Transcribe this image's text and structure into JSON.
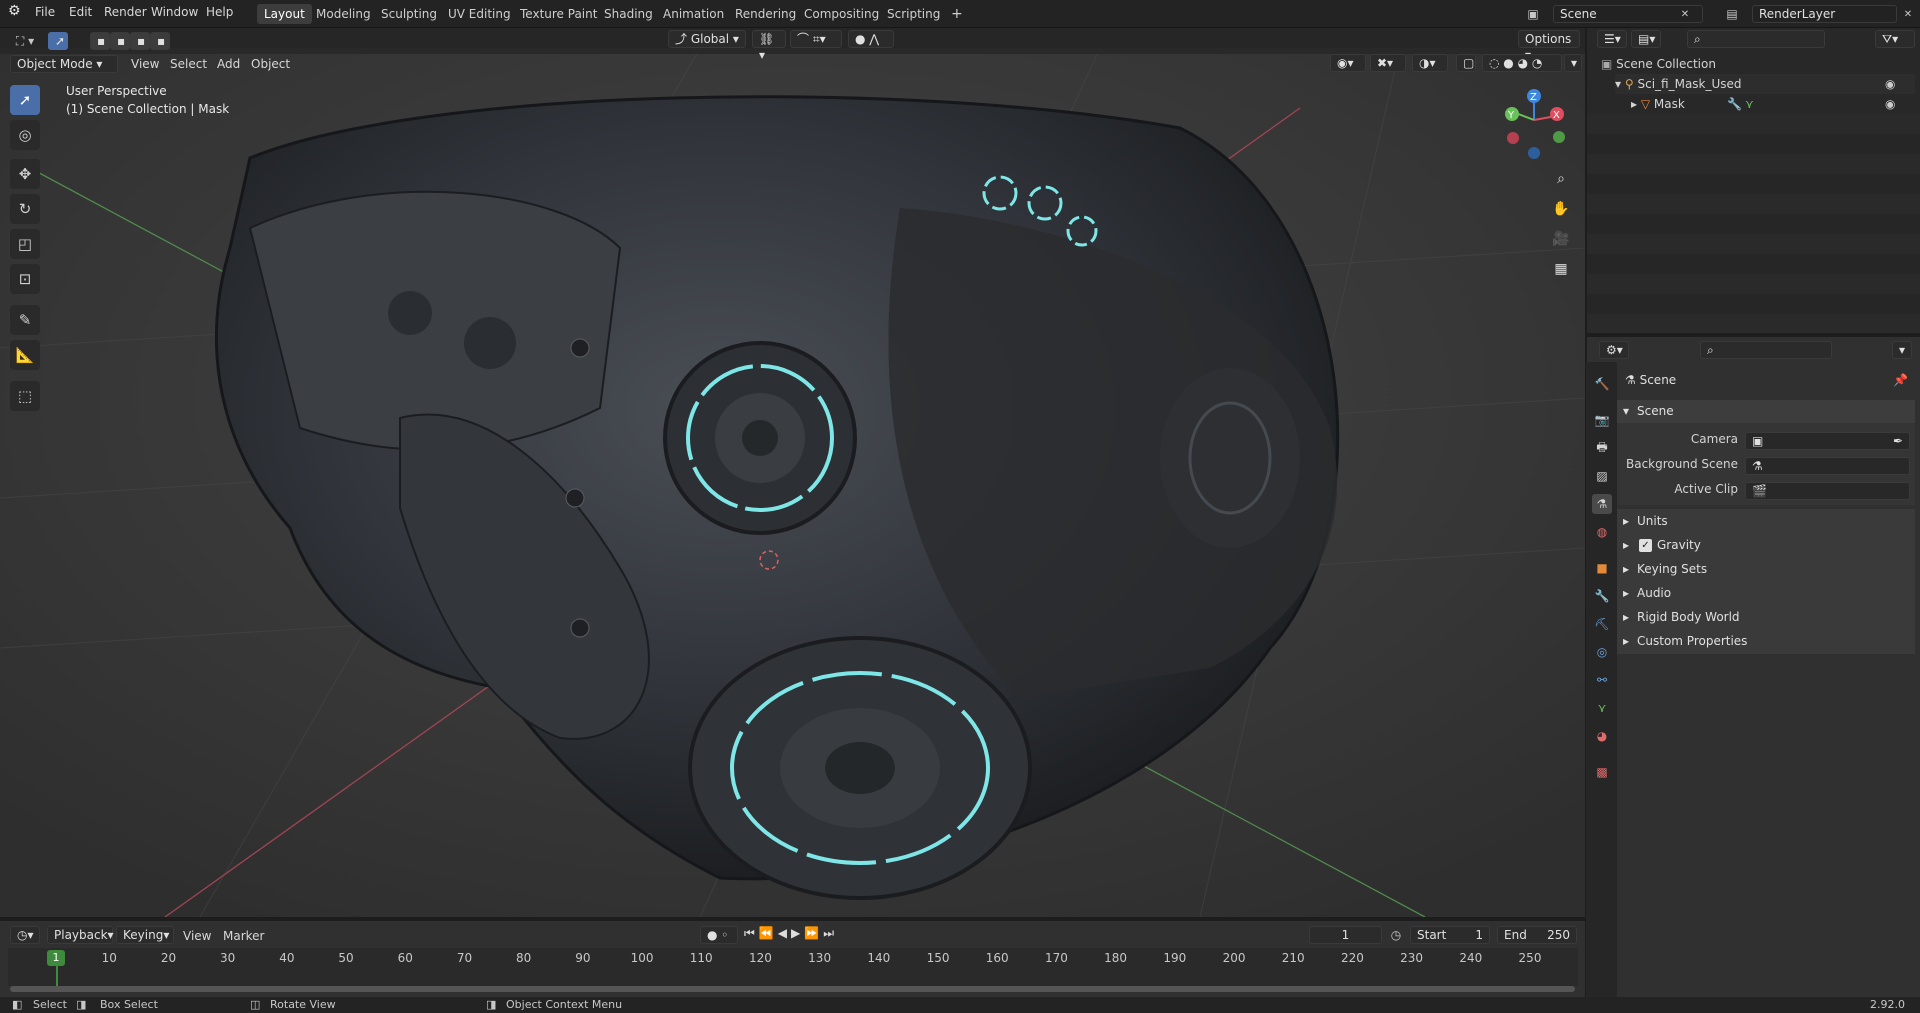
{
  "menubar": {
    "menus": [
      "File",
      "Edit",
      "Render",
      "Window",
      "Help"
    ],
    "workspaces": [
      "Layout",
      "Modeling",
      "Sculpting",
      "UV Editing",
      "Texture Paint",
      "Shading",
      "Animation",
      "Rendering",
      "Compositing",
      "Scripting"
    ],
    "active_workspace": "Layout",
    "add_tab": "+",
    "scene_name": "Scene",
    "view_layer": "RenderLayer"
  },
  "viewport_header": {
    "mode": "Object Mode",
    "menus": [
      "View",
      "Select",
      "Add",
      "Object"
    ],
    "transform_orientation": "Global",
    "options": "Options"
  },
  "viewport": {
    "perspective": "User Perspective",
    "collection_info": "(1) Scene Collection | Mask",
    "gizmo_axes": [
      "X",
      "Y",
      "Z"
    ]
  },
  "outliner": {
    "root": "Scene Collection",
    "items": [
      {
        "name": "Sci_fi_Mask_Used",
        "level": 1
      },
      {
        "name": "Mask",
        "level": 2
      }
    ]
  },
  "properties": {
    "context": "Scene",
    "panel": "Scene",
    "fields": [
      {
        "label": "Camera",
        "value": ""
      },
      {
        "label": "Background Scene",
        "value": ""
      },
      {
        "label": "Active Clip",
        "value": ""
      }
    ],
    "subpanels": [
      "Units",
      "Gravity",
      "Keying Sets",
      "Audio",
      "Rigid Body World",
      "Custom Properties"
    ],
    "gravity_checked": true
  },
  "timeline": {
    "menus": [
      "Playback",
      "Keying",
      "View",
      "Marker"
    ],
    "current_frame": "1",
    "start_label": "Start",
    "start": "1",
    "end_label": "End",
    "end": "250",
    "ticks": [
      "1",
      "10",
      "20",
      "30",
      "40",
      "50",
      "60",
      "70",
      "80",
      "90",
      "100",
      "110",
      "120",
      "130",
      "140",
      "150",
      "160",
      "170",
      "180",
      "190",
      "200",
      "210",
      "220",
      "230",
      "240",
      "250"
    ]
  },
  "statusbar": {
    "select": "Select",
    "box_select": "Box Select",
    "rotate_view": "Rotate View",
    "context_menu": "Object Context Menu",
    "version": "2.92.0"
  },
  "colors": {
    "accent_blue": "#4a6fa8",
    "axis_x": "#e04d5e",
    "axis_y": "#6ac05a",
    "axis_z": "#3f86e0",
    "glow": "#7fe6e8"
  }
}
